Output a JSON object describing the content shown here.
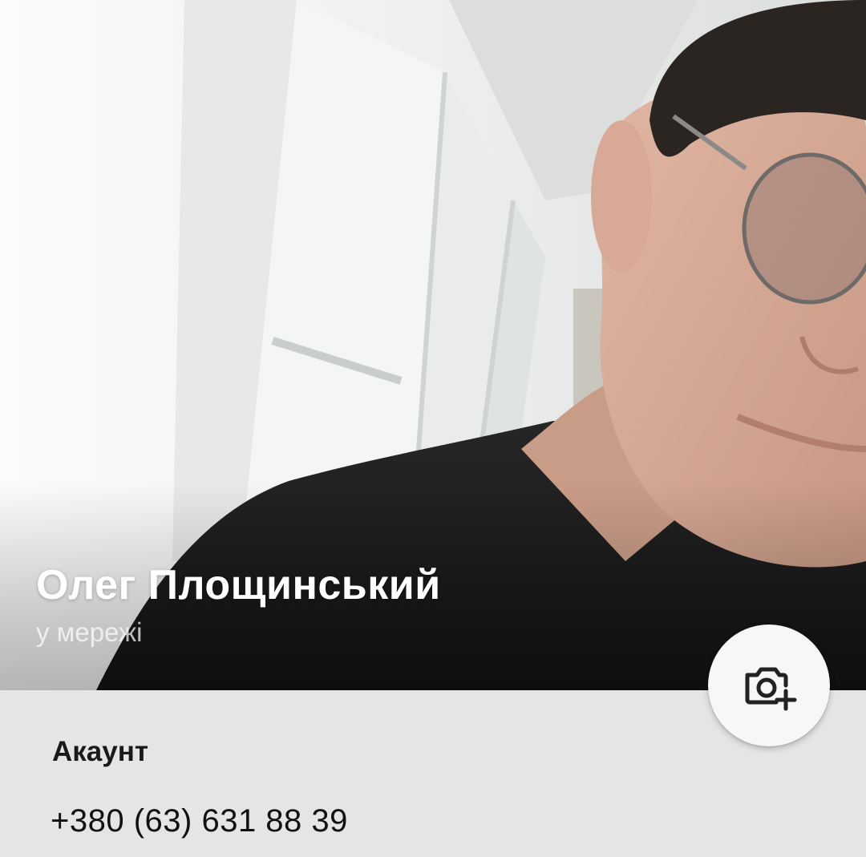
{
  "profile": {
    "name": "Олег Площинський",
    "status": "у мережі",
    "photo_icon": "profile-cover-photo"
  },
  "camera_button": {
    "icon": "camera-add-icon"
  },
  "account": {
    "section_title": "Акаунт",
    "phone": "+380 (63) 631 88 39"
  },
  "colors": {
    "background": "#e4e5e4",
    "name_text": "#ffffff",
    "status_text": "#b8b8b8",
    "fab_background": "#f7f7f7",
    "icon": "#222222"
  }
}
